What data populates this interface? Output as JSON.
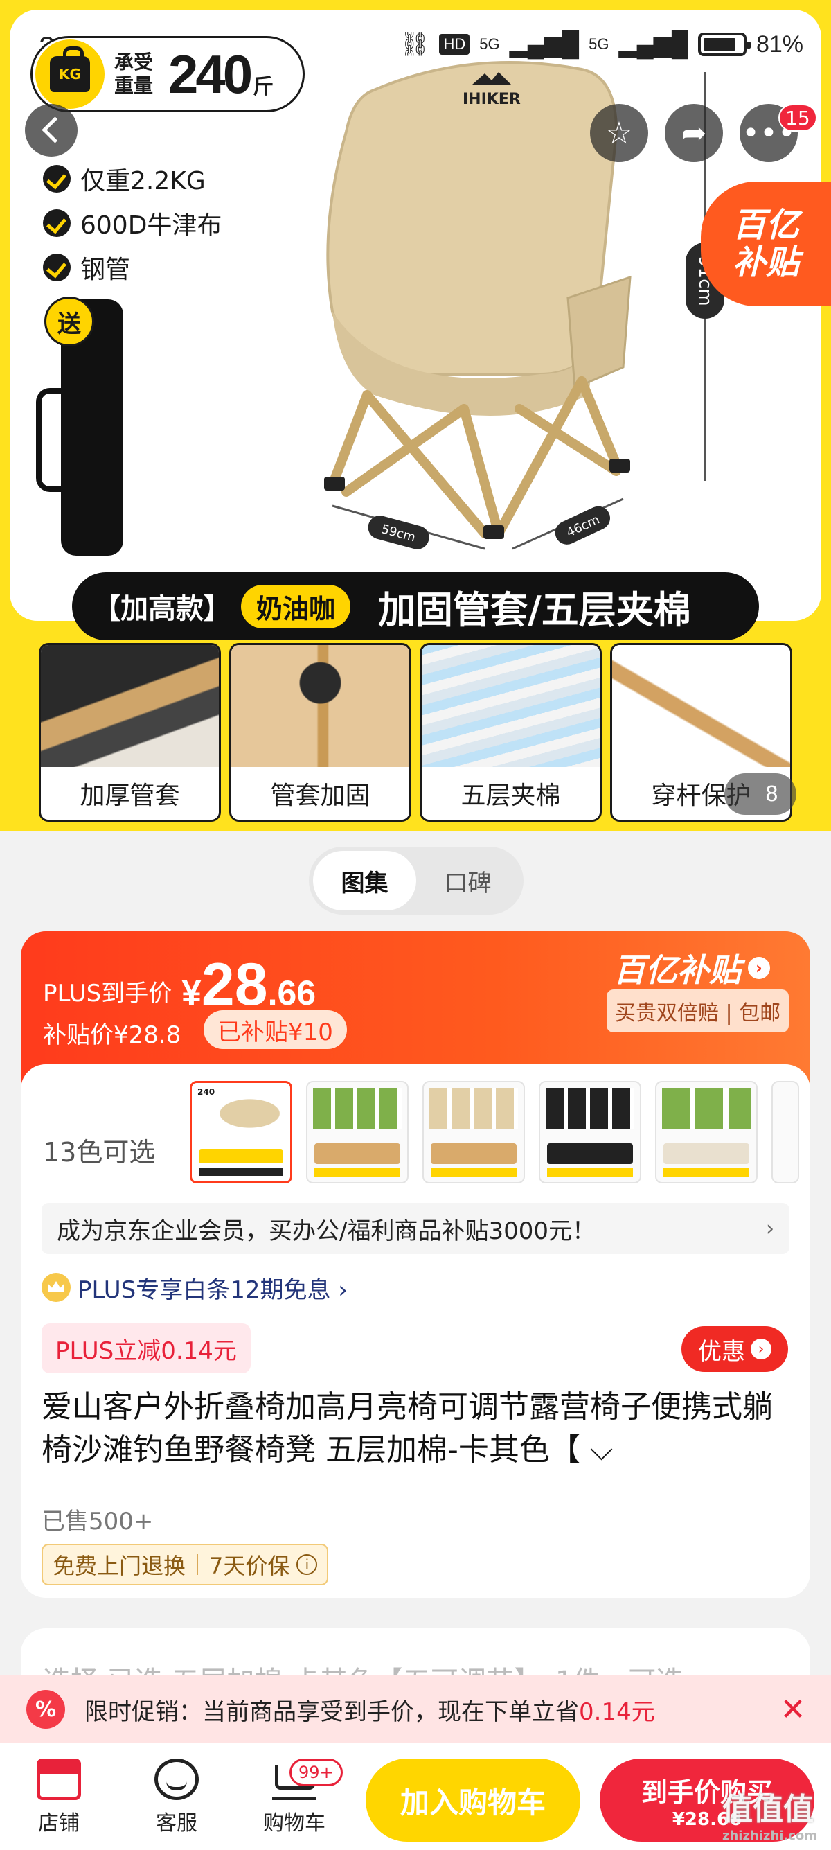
{
  "status_bar": {
    "time": "22:25",
    "network": "5G",
    "network2": "5G",
    "battery": "81%"
  },
  "hero": {
    "load_label": "承受重量",
    "load_value": "240",
    "load_unit": "斤",
    "features": [
      "仅重2.2KG",
      "600D牛津布",
      "钢管"
    ],
    "gift": "送",
    "brand": "IHIKER",
    "dim_height": "91cm",
    "dim_width": "59cm",
    "dim_depth": "46cm",
    "subsidy_line1": "百亿",
    "subsidy_line2": "补贴",
    "more_badge": "15",
    "bar_kind": "【加高款】",
    "bar_color": "奶油咖",
    "bar_feature": "加固管套/五层夹棉",
    "thumbs": [
      "加厚管套",
      "管套加固",
      "五层夹棉",
      "穿杆保护"
    ],
    "image_count": "8"
  },
  "tabs": [
    "图集",
    "口碑"
  ],
  "price": {
    "plus_label": "PLUS到手价",
    "currency": "¥",
    "plus_int": "28",
    "plus_dec": ".66",
    "sub_price": "补贴价¥28.8",
    "sub_tag": "已补贴¥10",
    "brand_logo": "百亿补贴",
    "brand_sub": "买贵双倍赔 | 包邮"
  },
  "product": {
    "color_count": "13色可选",
    "swatch_load": "240",
    "biz_bar": "成为京东企业会员，买办公/福利商品补贴3000元！",
    "plus_row": "PLUS专享白条12期免息 ›",
    "plus_off": "PLUS立减0.14元",
    "promo_btn": "优惠",
    "title": "爱山客户外折叠椅加高月亮椅可调节露营椅子便携式躺椅沙滩钓鱼野餐椅凳 五层加棉-卡其色【",
    "sold": "已售500+",
    "service1": "免费上门退换",
    "service2": "7天价保",
    "next_card": "选择  已选  五层加棉-卡其色【五可调节】，1件，可选"
  },
  "banner": {
    "label": "限时促销：当前商品享受到手价，现在下单立省",
    "amount": "0.14元",
    "icon": "%"
  },
  "bottom_bar": {
    "store": "店铺",
    "service": "客服",
    "cart": "购物车",
    "cart_badge": "99+",
    "add_cart": "加入购物车",
    "buy_line1": "到手价购买",
    "buy_line2": "¥28.66"
  },
  "watermark": {
    "main": "值值值",
    "sub": "zhizhizhi.com"
  },
  "colors": {
    "accent_yellow": "#ffe21e",
    "accent_red": "#f0263c",
    "orange": "#ff5a1e"
  }
}
